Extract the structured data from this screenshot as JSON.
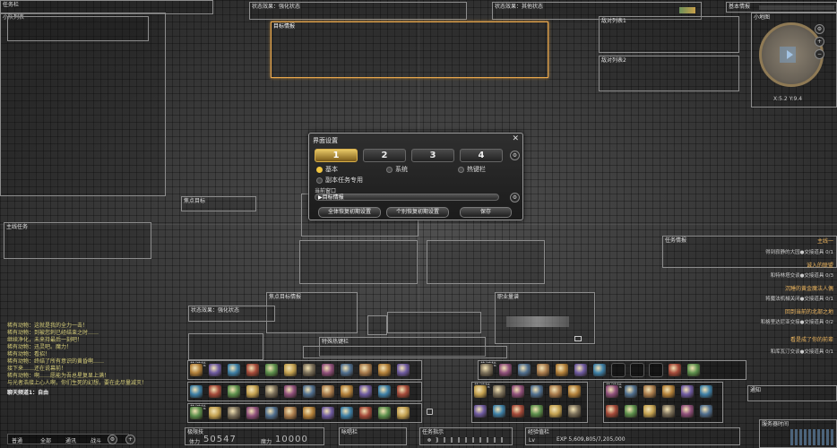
{
  "frames": {
    "top_left_small": "任务栏",
    "party_list": "小队列表",
    "status_strengthen": "状态效果：强化状态",
    "status_other": "状态效果：其他状态",
    "main_menu": "基本情报",
    "minimap": "小地图",
    "target_info": "目标情报",
    "enemy_list_1": "敌对列表1",
    "enemy_list_2": "敌对列表2",
    "focus_target": "焦点目标",
    "main_side": "主线任务",
    "task_info": "任务情报",
    "status_enhance_2": "状态效果：强化状态",
    "focus_target_2": "焦点目标情报",
    "duty_finder": "职业量谱",
    "hotbar_ex": "热键栏",
    "special": "特殊热键栏",
    "cast": "咏唱栏",
    "limit": "极限技",
    "notice": "通知",
    "mp_label": "魔力",
    "hp_label": "体力",
    "server": "服务器时间",
    "dots": "任务指示",
    "exp_label": "经验值栏"
  },
  "minimap": {
    "coords": "X:5.2 Y:9.4"
  },
  "dialog": {
    "title": "界面设置",
    "tabs": [
      "1",
      "2",
      "3",
      "4"
    ],
    "radio_basic": "基本",
    "radio_system": "系统",
    "radio_hotbar": "热键栏",
    "radio_duty": "副本任务专用",
    "current_window_label": "当前窗口",
    "current_window_value": "▶目标情报",
    "btn_reset_all": "全体恢复初期设置",
    "btn_reset_one": "个别恢复初期设置",
    "btn_save": "保存"
  },
  "chat": {
    "lines": [
      "稀有动物：这就是我的全力一击！",
      "稀有动物：到被您刺已经结束之时……",
      "  继续净化，未来持最后一刻吧！",
      "稀有动物：迅灵吧。魔力！",
      "稀有动物：看招！",
      "稀有动物：终结了所有意识的黄昏啊……",
      "  接下来……还在说幕前！",
      "稀有动物：啊……愿能为吾总星复显上满！",
      "  与光者浩接上心人啊，你们生死的幻想，要在此尽量减灭！"
    ],
    "footer": "聊天频道1：自由",
    "tabs": [
      "普通",
      "全部",
      "通讯",
      "战斗"
    ]
  },
  "quests": [
    {
      "title": "主线一",
      "sub": "得到寂静的大园●交接道具 0/1"
    },
    {
      "title": "诚入的联盟",
      "sub": "和特林塔交谈●交接道具 0/3"
    },
    {
      "title": "沉睡的黄金魔法人偶",
      "sub": "将魔法机械关闭●交接道具 0/1"
    },
    {
      "title": "回到当前的北部之地",
      "sub": "和格里达尼亚交接●交接道具 0/2"
    },
    {
      "title": "看是成了你的前辈",
      "sub": "和库瓦汀交谈●交接道具 0/1"
    }
  ],
  "hp_value": "50547",
  "mp_value": "10000",
  "exp_text": "EXP 5,609,805/7,205,000",
  "level_text": "Lv",
  "colors": {
    "accent": "#e8a64a",
    "frame_border": "#8c8c8c",
    "target_border": "#e8a64a"
  }
}
